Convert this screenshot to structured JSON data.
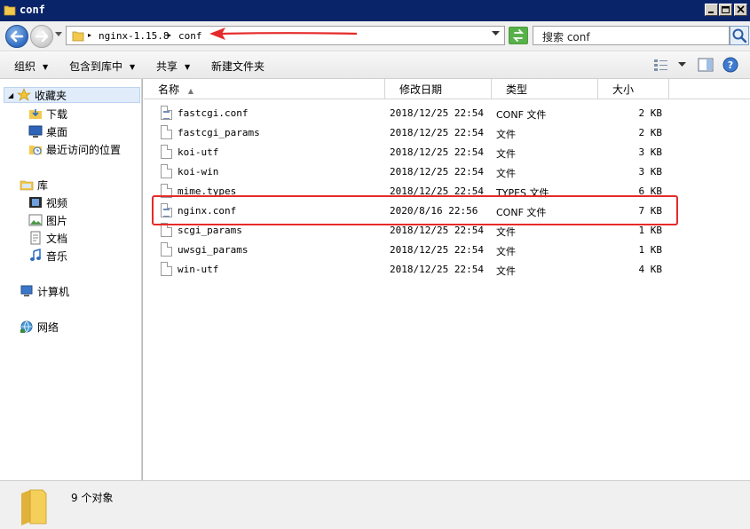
{
  "window": {
    "title": "conf"
  },
  "address": {
    "crumbs": [
      "nginx-1.15.8",
      "conf"
    ],
    "search_placeholder": "搜索 conf"
  },
  "toolbar": {
    "organize": "组织",
    "include_in_library": "包含到库中",
    "share": "共享",
    "new_folder": "新建文件夹"
  },
  "sidebar": {
    "favorites": {
      "label": "收藏夹",
      "items": [
        "下载",
        "桌面",
        "最近访问的位置"
      ]
    },
    "libraries": {
      "label": "库",
      "items": [
        "视频",
        "图片",
        "文档",
        "音乐"
      ]
    },
    "computer": "计算机",
    "network": "网络"
  },
  "columns": {
    "name": "名称",
    "modified": "修改日期",
    "type": "类型",
    "size": "大小"
  },
  "files": [
    {
      "name": "fastcgi.conf",
      "modified": "2018/12/25 22:54",
      "type": "CONF 文件",
      "size": "2 KB",
      "icon": "conf-file-icon"
    },
    {
      "name": "fastcgi_params",
      "modified": "2018/12/25 22:54",
      "type": "文件",
      "size": "2 KB",
      "icon": "file-icon"
    },
    {
      "name": "koi-utf",
      "modified": "2018/12/25 22:54",
      "type": "文件",
      "size": "3 KB",
      "icon": "file-icon"
    },
    {
      "name": "koi-win",
      "modified": "2018/12/25 22:54",
      "type": "文件",
      "size": "3 KB",
      "icon": "file-icon"
    },
    {
      "name": "mime.types",
      "modified": "2018/12/25 22:54",
      "type": "TYPES 文件",
      "size": "6 KB",
      "icon": "file-icon"
    },
    {
      "name": "nginx.conf",
      "modified": "2020/8/16 22:56",
      "type": "CONF 文件",
      "size": "7 KB",
      "icon": "conf-file-icon"
    },
    {
      "name": "scgi_params",
      "modified": "2018/12/25 22:54",
      "type": "文件",
      "size": "1 KB",
      "icon": "file-icon"
    },
    {
      "name": "uwsgi_params",
      "modified": "2018/12/25 22:54",
      "type": "文件",
      "size": "1 KB",
      "icon": "file-icon"
    },
    {
      "name": "win-utf",
      "modified": "2018/12/25 22:54",
      "type": "文件",
      "size": "4 KB",
      "icon": "file-icon"
    }
  ],
  "status": {
    "count_text": "9 个对象"
  },
  "colors": {
    "highlight": "#e62a2a",
    "titlebar": "#0a246a"
  }
}
